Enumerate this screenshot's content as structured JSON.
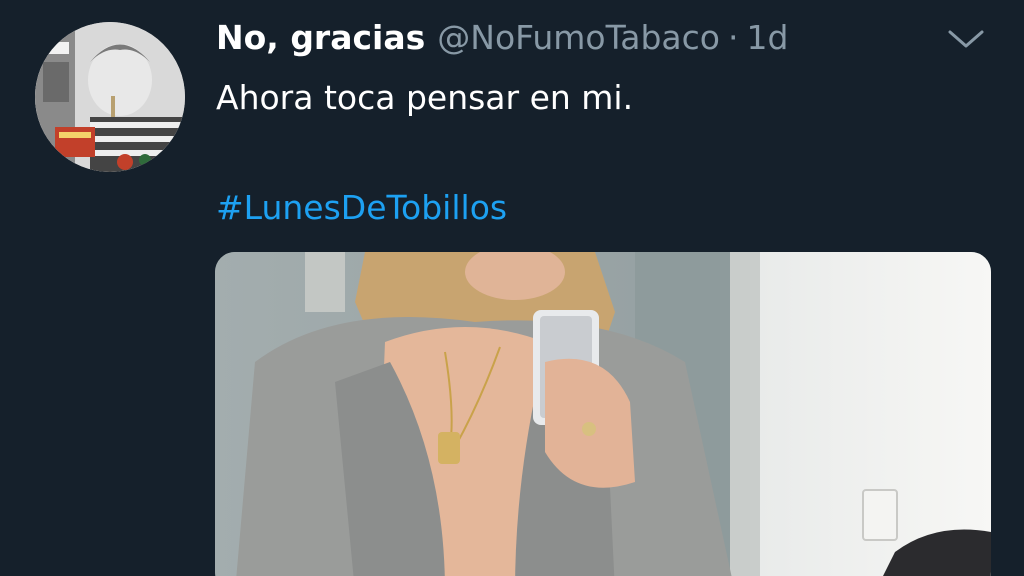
{
  "tweet": {
    "display_name": "No, gracias",
    "handle": "@NoFumoTabaco",
    "separator": "·",
    "time": "1d",
    "text_line1": "Ahora toca pensar en mi.",
    "hashtag": "#LunesDeTobillos"
  },
  "icons": {
    "menu": "chevron-down-icon"
  },
  "colors": {
    "background": "#15202b",
    "primary_text": "#ffffff",
    "secondary_text": "#8899a6",
    "link": "#1da1f2"
  }
}
